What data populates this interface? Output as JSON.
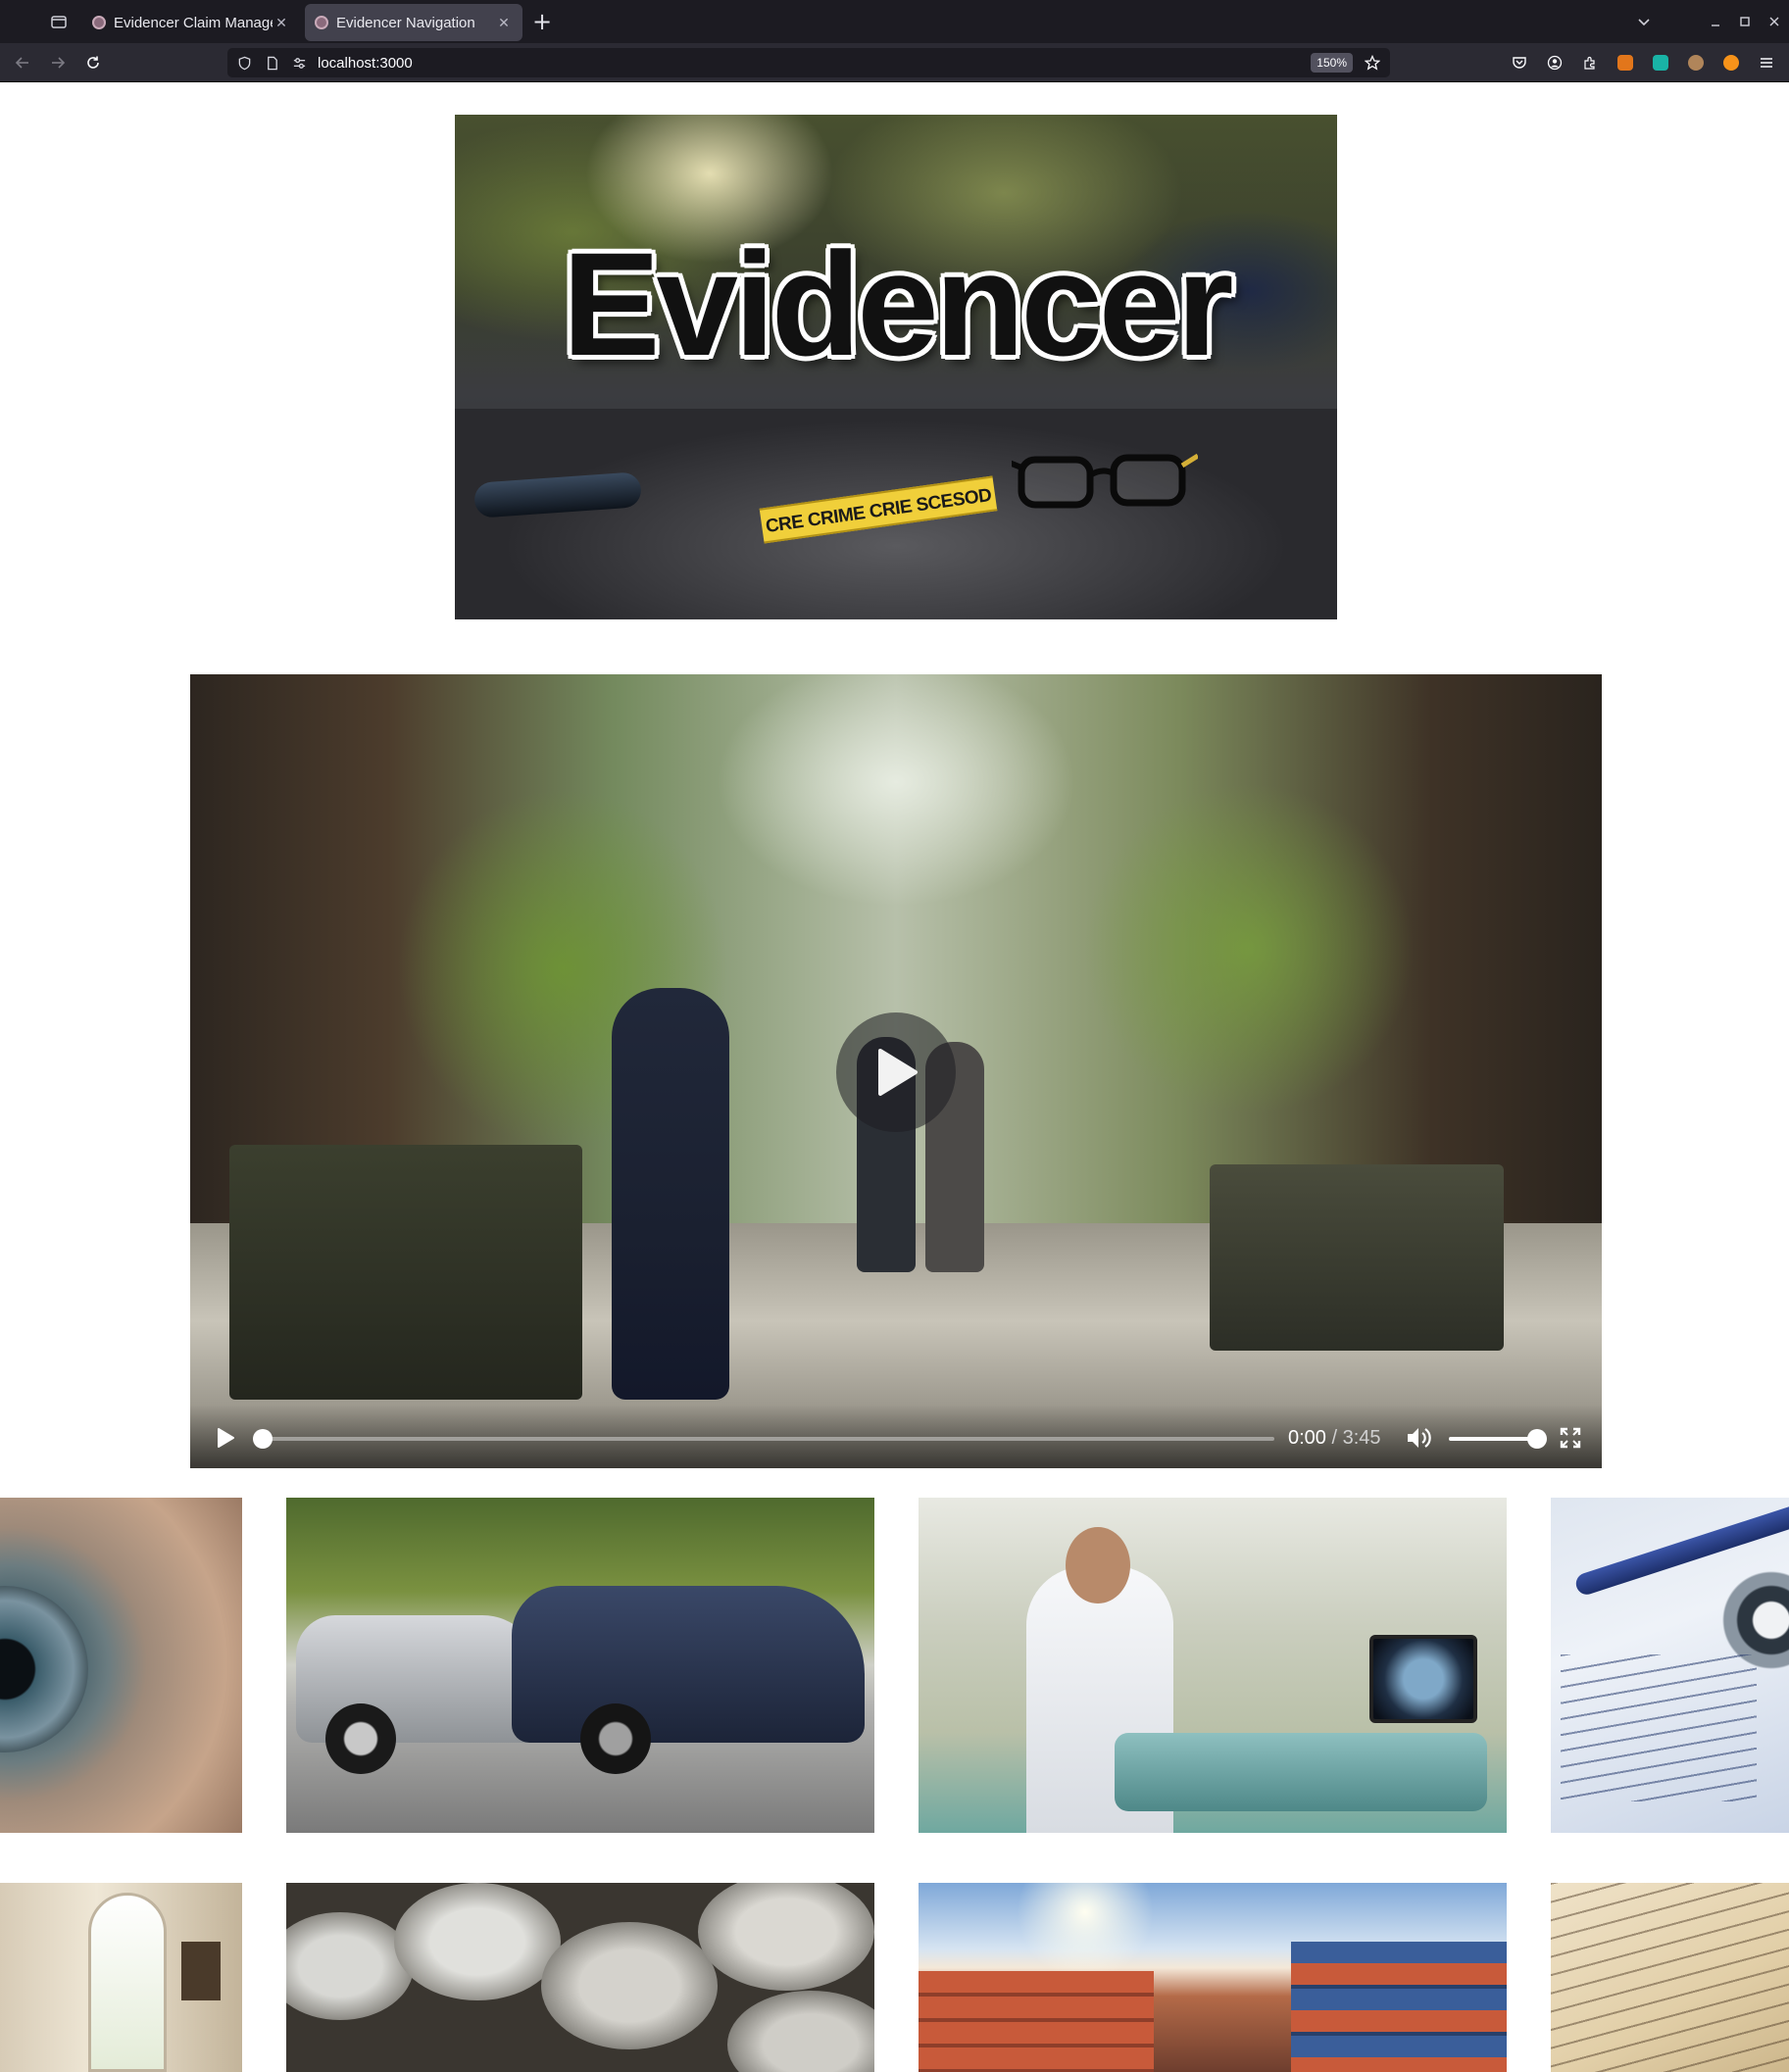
{
  "browser": {
    "tabs": [
      {
        "title": "Evidencer Claim Manager",
        "active": false
      },
      {
        "title": "Evidencer Navigation",
        "active": true
      }
    ],
    "url": "localhost:3000",
    "zoom": "150%"
  },
  "hero": {
    "logo_text": "Evidencer",
    "tape_text": "CRE CRIME CRIE SCESOD"
  },
  "video": {
    "current_time": "0:00",
    "separator": "/",
    "duration": "3:45",
    "progress": 0,
    "volume": 1
  },
  "gallery": [
    {
      "name": "eye-closeup-image"
    },
    {
      "name": "car-crash-image"
    },
    {
      "name": "medical-lab-image"
    },
    {
      "name": "insurance-claim-form-image"
    },
    {
      "name": "room-interior-image"
    },
    {
      "name": "coins-image"
    },
    {
      "name": "shipping-containers-image"
    },
    {
      "name": "old-document-image"
    }
  ]
}
